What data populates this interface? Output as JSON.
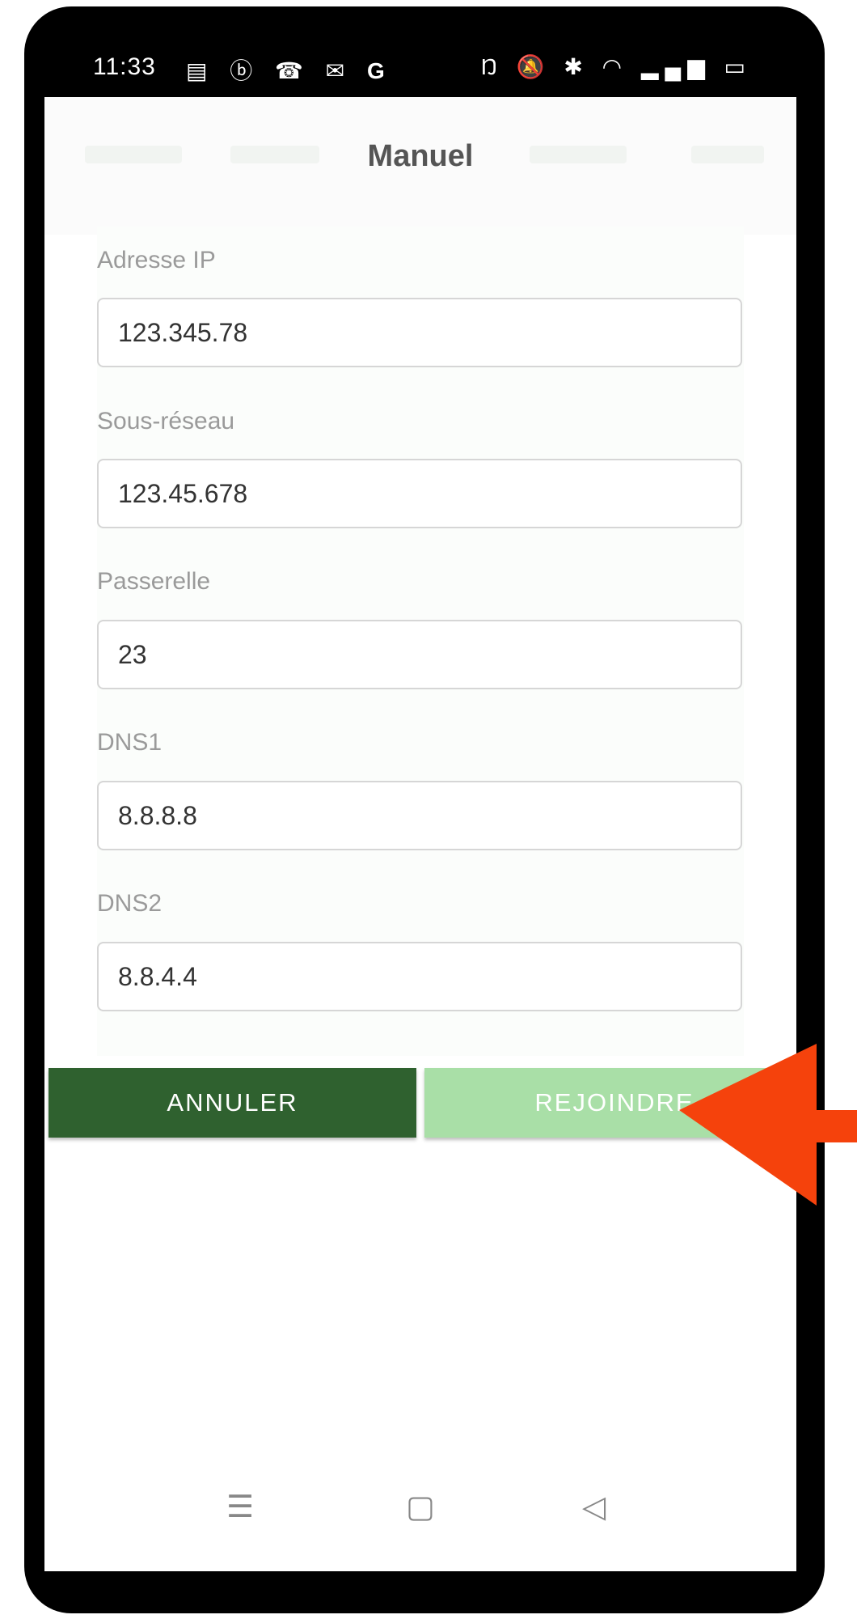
{
  "status_bar": {
    "time": "11:33",
    "left_icons": [
      "notes-icon",
      "b-circle-icon",
      "missed-call-icon",
      "mail-icon",
      "google-icon"
    ],
    "right_icons": [
      "nfc-icon",
      "mute-icon",
      "bluetooth-icon",
      "wifi-icon",
      "signal-icon",
      "battery-icon"
    ]
  },
  "dialog": {
    "title": "Manuel",
    "fields": [
      {
        "label": "Adresse IP",
        "value": "123.345.78"
      },
      {
        "label": "Sous-réseau",
        "value": "123.45.678"
      },
      {
        "label": "Passerelle",
        "value": "23"
      },
      {
        "label": "DNS1",
        "value": "8.8.8.8"
      },
      {
        "label": "DNS2",
        "value": "8.8.4.4"
      }
    ],
    "cancel_label": "ANNULER",
    "join_label": "REJOINDRE"
  },
  "nav_bar": {
    "icons": [
      "menu-icon",
      "home-icon",
      "back-icon"
    ]
  },
  "colors": {
    "cancel_button": "#2f612f",
    "join_button": "#a9dfa7",
    "annotation_arrow": "#f5420c"
  }
}
